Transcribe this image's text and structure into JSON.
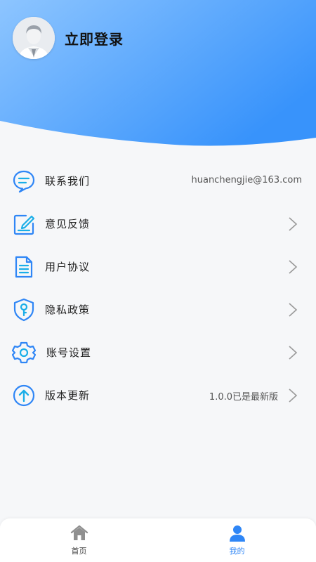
{
  "profile": {
    "login_label": "立即登录"
  },
  "menu": [
    {
      "label": "联系我们",
      "value": "huanchengjie@163.com",
      "icon": "chat-bubble-icon"
    },
    {
      "label": "意见反馈",
      "value": "",
      "icon": "feedback-edit-icon"
    },
    {
      "label": "用户协议",
      "value": "",
      "icon": "document-icon"
    },
    {
      "label": "隐私政策",
      "value": "",
      "icon": "shield-key-icon"
    },
    {
      "label": "账号设置",
      "value": "",
      "icon": "gear-icon"
    },
    {
      "label": "版本更新",
      "value": "1.0.0已是最新版",
      "icon": "upload-arrow-icon"
    }
  ],
  "tabs": [
    {
      "label": "首页",
      "icon": "home-icon",
      "active": false
    },
    {
      "label": "我的",
      "icon": "person-icon",
      "active": true
    }
  ],
  "colors": {
    "accent": "#2f86f6",
    "header_gradient_start": "#8cc4ff",
    "header_gradient_end": "#3c97fc",
    "page_background": "#f6f7f9"
  }
}
